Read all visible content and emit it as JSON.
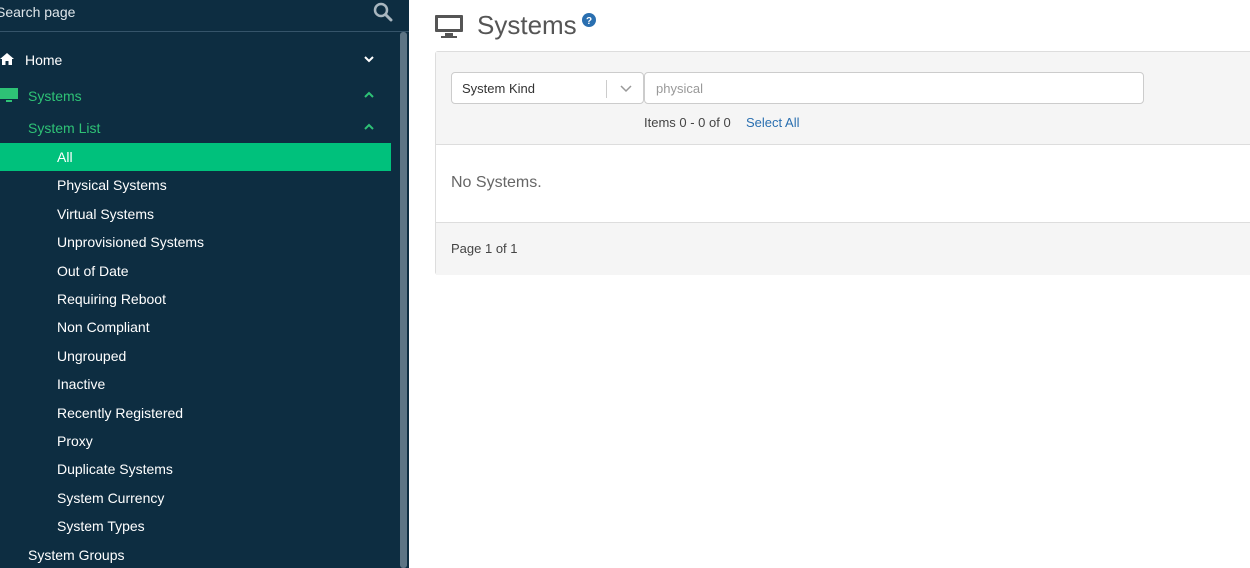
{
  "sidebar": {
    "search_placeholder": "Search page",
    "home": {
      "label": "Home"
    },
    "systems": {
      "label": "Systems"
    },
    "system_list": {
      "label": "System List"
    },
    "active_item": "All",
    "items": [
      "Physical Systems",
      "Virtual Systems",
      "Unprovisioned Systems",
      "Out of Date",
      "Requiring Reboot",
      "Non Compliant",
      "Ungrouped",
      "Inactive",
      "Recently Registered",
      "Proxy",
      "Duplicate Systems",
      "System Currency",
      "System Types"
    ],
    "system_groups": {
      "label": "System Groups"
    },
    "colors": {
      "background": "#0d2d41",
      "accent": "#2ec276",
      "active": "#00c17c"
    }
  },
  "main": {
    "title": "Systems",
    "filter": {
      "select_label": "System Kind",
      "input_placeholder": "physical",
      "items_count": "Items 0 - 0 of 0",
      "select_all": "Select All"
    },
    "empty_message": "No Systems.",
    "page_info": "Page 1 of 1",
    "colors": {
      "link": "#2a6fb0",
      "help": "#2a6fb0"
    }
  }
}
